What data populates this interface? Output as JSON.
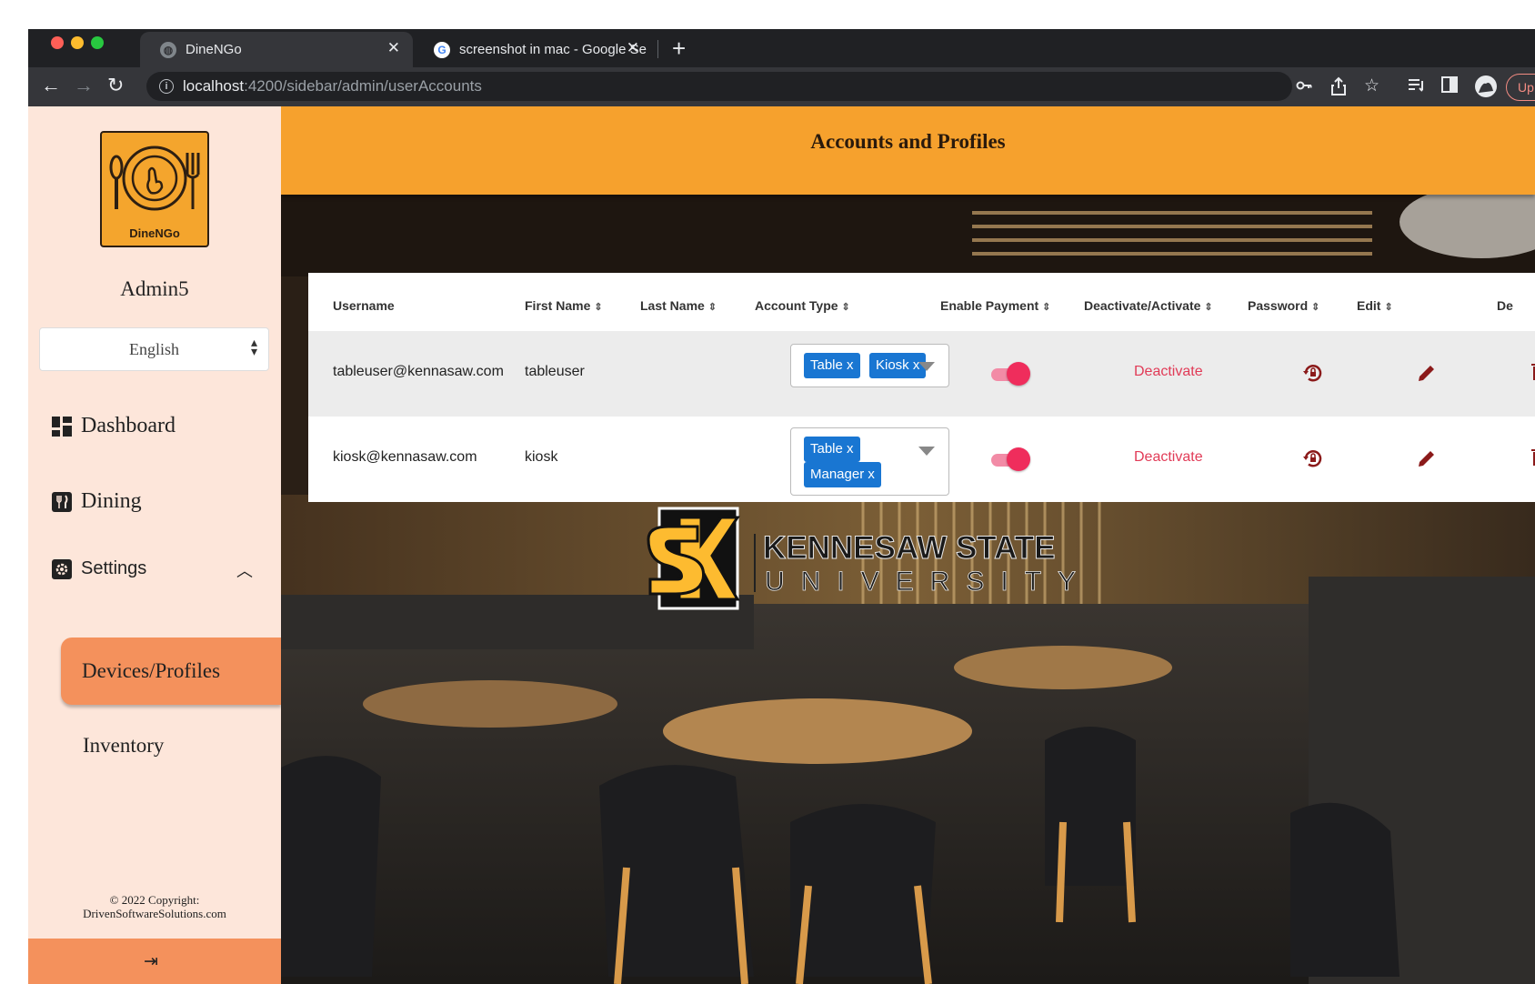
{
  "browser": {
    "tabs": [
      {
        "title": "DineNGo",
        "active": true
      },
      {
        "title": "screenshot in mac - Google Se",
        "active": false
      }
    ],
    "url_host": "localhost",
    "url_rest": ":4200/sidebar/admin/userAccounts",
    "update_label": "Up"
  },
  "sidebar": {
    "logo_text": "DineNGo",
    "admin_name": "Admin5",
    "language": "English",
    "nav": {
      "dashboard": "Dashboard",
      "dining": "Dining",
      "settings": "Settings",
      "devices_profiles": "Devices/Profiles",
      "inventory": "Inventory"
    },
    "copyright_line1": "© 2022 Copyright:",
    "copyright_line2": "DrivenSoftwareSolutions.com"
  },
  "main": {
    "title": "Accounts and Profiles",
    "columns": {
      "username": "Username",
      "first_name": "First Name",
      "last_name": "Last Name",
      "account_type": "Account Type",
      "enable_payment": "Enable Payment",
      "deactivate_activate": "Deactivate/Activate",
      "password": "Password",
      "edit": "Edit",
      "delete": "De"
    },
    "rows": [
      {
        "username": "tableuser@kennasaw.com",
        "first_name": "tableuser",
        "last_name": "",
        "chips": [
          "Table x",
          "Kiosk x"
        ],
        "payment_enabled": true,
        "action": "Deactivate"
      },
      {
        "username": "kiosk@kennasaw.com",
        "first_name": "kiosk",
        "last_name": "",
        "chips": [
          "Table x",
          "Manager x"
        ],
        "payment_enabled": true,
        "action": "Deactivate"
      }
    ],
    "watermark": {
      "line1": "KENNESAW STATE",
      "line2": "UNIVERSITY"
    }
  },
  "colors": {
    "banner": "#f6a12d",
    "sidebar_bg": "#fde6da",
    "active_item": "#f4915c",
    "chip": "#1976d2",
    "toggle": "#ef2d5c",
    "deactivate_text": "#e13b57",
    "icon_maroon": "#8b1a1a"
  }
}
